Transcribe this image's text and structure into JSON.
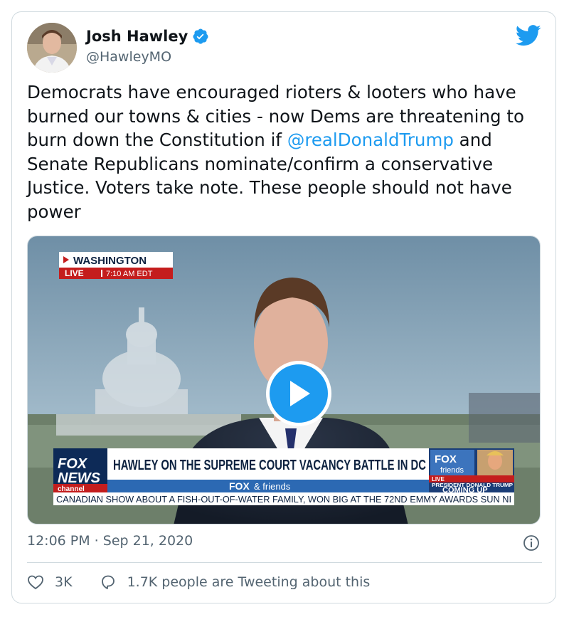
{
  "author": {
    "name": "Josh Hawley",
    "handle": "@HawleyMO"
  },
  "tweet": {
    "text_part1": "Democrats have encouraged rioters & looters who have burned our towns & cities - now Dems are threatening to burn down the Constitution if ",
    "mention": "@realDonaldTrump",
    "text_part2": " and Senate Republicans nominate/confirm a conservative Justice. Voters take note. These people should not have power"
  },
  "video": {
    "location_label": "WASHINGTON",
    "live_label": "LIVE",
    "live_time": "7:10 AM EDT",
    "network_logo_1": "FOX",
    "network_logo_2": "NEWS",
    "network_logo_3": "channel",
    "headline": "HAWLEY ON THE SUPREME COURT VACANCY BATTLE IN DC",
    "show_name_1": "FOX",
    "show_name_2": "& friends",
    "promo_logo_1": "FOX",
    "promo_logo_2": "friends",
    "promo_live": "LIVE",
    "promo_subject": "PRESIDENT DONALD TRUMP",
    "promo_coming_up": "COMING UP",
    "ticker": "CANADIAN SHOW ABOUT A FISH-OUT-OF-WATER FAMILY, WON BIG AT THE 72ND EMMY AWARDS SUN NI"
  },
  "meta": {
    "timestamp": "12:06 PM · Sep 21, 2020"
  },
  "engagement": {
    "likes": "3K",
    "replies_text": "1.7K people are Tweeting about this"
  },
  "colors": {
    "accent": "#1d9bf0",
    "text": "#0f1419",
    "secondary": "#536471",
    "border": "#cfd9de"
  },
  "icons": [
    "verified-badge-icon",
    "twitter-bird-icon",
    "play-icon",
    "info-icon",
    "heart-icon",
    "reply-bubble-icon"
  ]
}
